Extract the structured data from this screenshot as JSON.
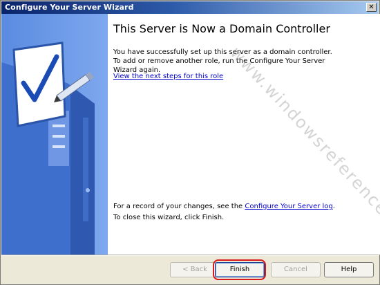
{
  "window": {
    "title": "Configure Your Server Wizard",
    "close_glyph": "✕"
  },
  "content": {
    "heading": "This Server is Now a Domain Controller",
    "intro": "You have successfully set up this server as a domain controller. To add or remove another role, run the Configure Your Server Wizard again.",
    "next_steps_link": "View the next steps for this role",
    "log_prefix": "For a record of your changes, see the ",
    "log_link": "Configure Your Server log",
    "log_suffix": ".",
    "close_hint": "To close this wizard, click Finish."
  },
  "watermark": "www.windowsreference.com",
  "buttons": {
    "back": "< Back",
    "finish": "Finish",
    "cancel": "Cancel",
    "help": "Help"
  },
  "colors": {
    "titlebar_start": "#0a246a",
    "side_panel": "#6e9ae6",
    "link": "#0000cc",
    "highlight_ring": "#d81a1a"
  },
  "icons": {
    "side_illustration": "server-checklist-illustration",
    "close": "close-icon"
  }
}
